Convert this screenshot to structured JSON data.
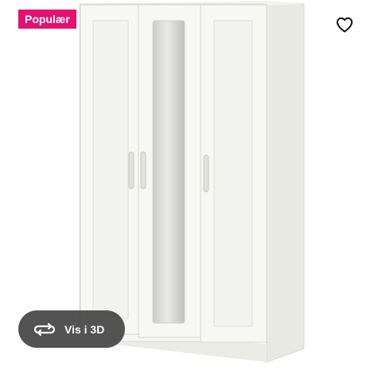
{
  "badge": {
    "label": "Populær",
    "color": "#e5106f"
  },
  "favorite": {
    "icon": "heart-outline-icon"
  },
  "view3d": {
    "label": "Vis i 3D",
    "icon": "rotate-3d-icon"
  },
  "product_image": {
    "subject": "wardrobe-three-doors-with-mirror"
  }
}
